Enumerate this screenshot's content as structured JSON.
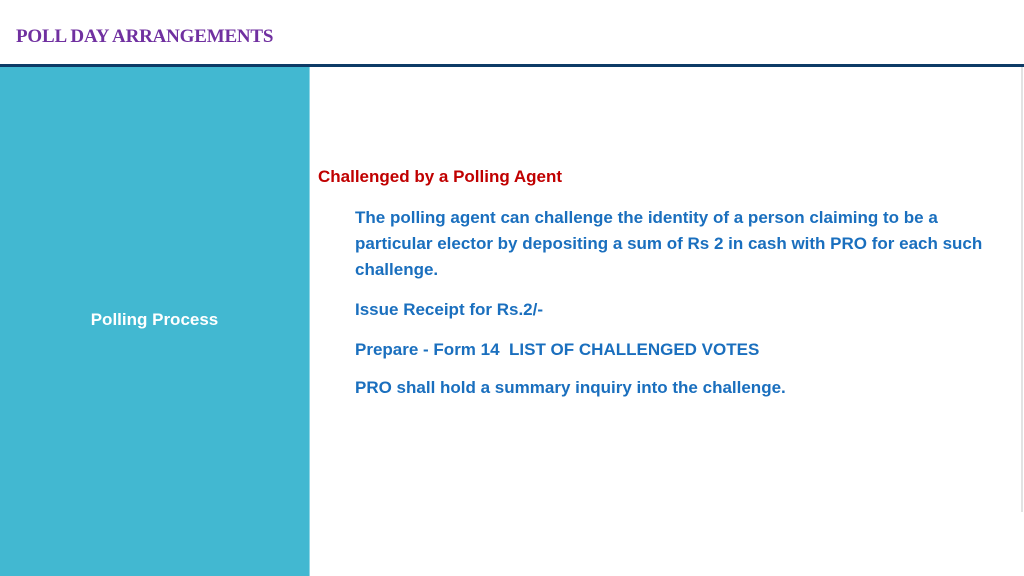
{
  "header": {
    "title": "POLL DAY ARRANGEMENTS"
  },
  "sidebar": {
    "label": "Polling Process"
  },
  "content": {
    "heading": "Challenged by a Polling Agent",
    "paragraphs": [
      "The polling agent can challenge the identity of a person claiming to be a particular elector by depositing a sum of Rs 2 in cash with PRO for each such challenge.",
      "Issue Receipt for Rs.2/-",
      "Prepare - Form 14  LIST OF CHALLENGED VOTES",
      "PRO shall hold a summary inquiry into the challenge."
    ]
  },
  "colors": {
    "title": "#7030a0",
    "rule": "#0d3b66",
    "sidebar_bg": "#42b8d1",
    "heading": "#c00000",
    "body_text": "#1a6fbe"
  }
}
